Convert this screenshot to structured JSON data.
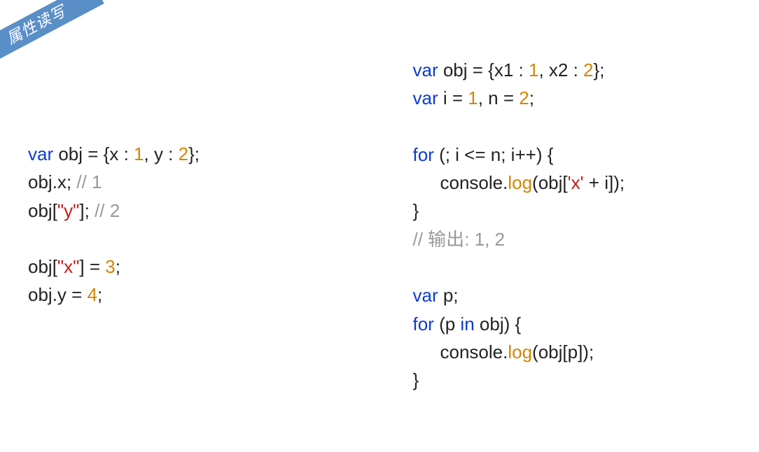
{
  "ribbon": "属性读写",
  "left": {
    "l1": {
      "a": "var",
      "b": " obj = {x : ",
      "c": "1",
      "d": ", y : ",
      "e": "2",
      "f": "};"
    },
    "l2": {
      "a": "obj.x; ",
      "b": "// 1"
    },
    "l3": {
      "a": "obj[",
      "b": "\"y\"",
      "c": "]; ",
      "d": "// 2"
    },
    "l4": {
      "a": "obj[",
      "b": "\"x\"",
      "c": "] = ",
      "d": "3",
      "e": ";"
    },
    "l5": {
      "a": "obj.y = ",
      "b": "4",
      "c": ";"
    }
  },
  "right": {
    "l1": {
      "a": "var",
      "b": " obj = {x1 : ",
      "c": "1",
      "d": ", x2 : ",
      "e": "2",
      "f": "};"
    },
    "l2": {
      "a": "var",
      "b": " i = ",
      "c": "1",
      "d": ", n = ",
      "e": "2",
      "f": ";"
    },
    "l3": {
      "a": "for",
      "b": " (; i <= n; i++) {"
    },
    "l4": {
      "a": "console.",
      "b": "log",
      "c": "(obj[",
      "d": "'x'",
      "e": " + i]);"
    },
    "l5": {
      "a": "}"
    },
    "l6": {
      "a": "// 输出: 1, 2"
    },
    "l7": {
      "a": "var",
      "b": " p;"
    },
    "l8": {
      "a": "for",
      "b": " (p ",
      "c": "in",
      "d": " obj) {"
    },
    "l9": {
      "a": "console.",
      "b": "log",
      "c": "(obj[p]);"
    },
    "l10": {
      "a": "}"
    }
  }
}
